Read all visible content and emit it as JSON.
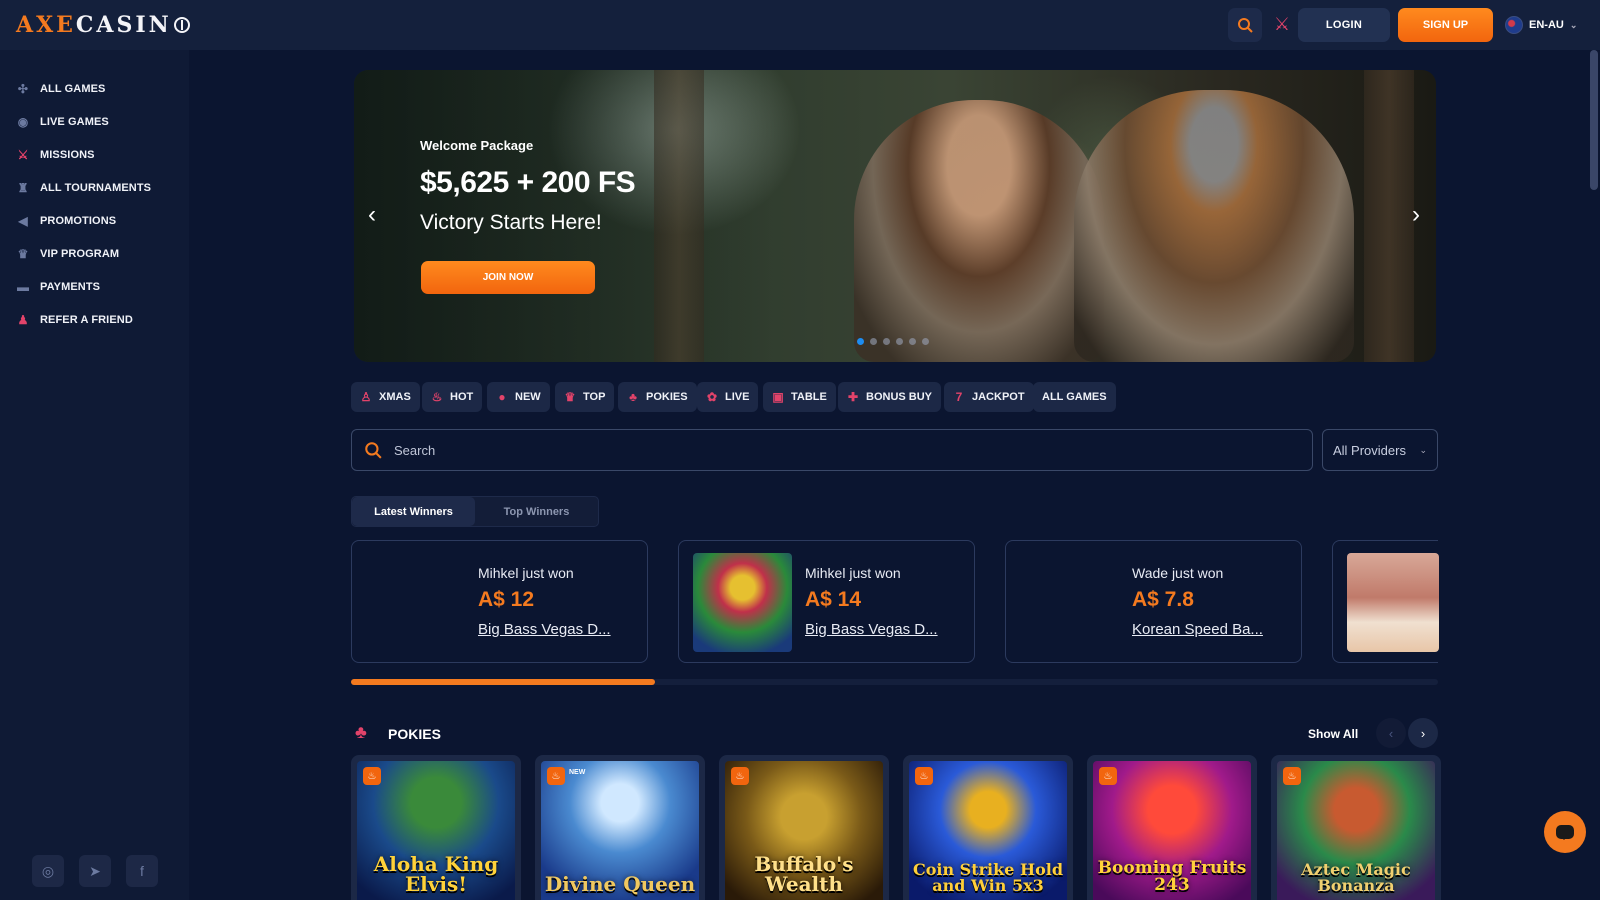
{
  "brand": {
    "logo_text": "AXECASINO",
    "accent": "#f47a1f",
    "pink": "#e2436a"
  },
  "header": {
    "search_icon": "search-icon",
    "missions_icon": "missions-icon",
    "login_label": "LOGIN",
    "signup_label": "SIGN UP",
    "language": "EN-AU"
  },
  "sidebar": {
    "items": [
      {
        "label": "ALL GAMES",
        "icon": "dice-icon"
      },
      {
        "label": "LIVE GAMES",
        "icon": "live-chip-icon"
      },
      {
        "label": "MISSIONS",
        "icon": "missions-icon"
      },
      {
        "label": "ALL TOURNAMENTS",
        "icon": "trophy-icon"
      },
      {
        "label": "PROMOTIONS",
        "icon": "megaphone-icon"
      },
      {
        "label": "VIP PROGRAM",
        "icon": "crown-icon"
      },
      {
        "label": "PAYMENTS",
        "icon": "wallet-icon"
      },
      {
        "label": "REFER A FRIEND",
        "icon": "users-icon"
      }
    ],
    "social": [
      "instagram-icon",
      "telegram-icon",
      "facebook-icon"
    ]
  },
  "banner": {
    "subtitle": "Welcome Package",
    "title": "$5,625 + 200 FS",
    "tagline": "Victory Starts Here!",
    "cta_label": "JOIN NOW",
    "slide_count": 6,
    "active_slide": 1
  },
  "categories": [
    {
      "label": "XMAS",
      "icon": "xmas-icon"
    },
    {
      "label": "HOT",
      "icon": "flame-icon"
    },
    {
      "label": "NEW",
      "icon": "new-icon"
    },
    {
      "label": "TOP",
      "icon": "crown-icon"
    },
    {
      "label": "POKIES",
      "icon": "cherry-icon"
    },
    {
      "label": "LIVE",
      "icon": "live-chip-icon"
    },
    {
      "label": "TABLE",
      "icon": "table-icon"
    },
    {
      "label": "BONUS BUY",
      "icon": "gift-icon"
    },
    {
      "label": "JACKPOT",
      "icon": "seven-icon"
    },
    {
      "label": "ALL GAMES",
      "icon": ""
    }
  ],
  "search": {
    "placeholder": "Search",
    "value": ""
  },
  "providers": {
    "selected": "All Providers"
  },
  "winners": {
    "tabs": [
      {
        "label": "Latest Winners",
        "active": true
      },
      {
        "label": "Top Winners",
        "active": false
      }
    ],
    "cards": [
      {
        "name": "Mihkel just won",
        "amount": "A$ 12",
        "game": "Big Bass Vegas D..."
      },
      {
        "name": "Mihkel just won",
        "amount": "A$ 14",
        "game": "Big Bass Vegas D..."
      },
      {
        "name": "Wade just won",
        "amount": "A$ 7.8",
        "game": "Korean Speed Ba..."
      },
      {
        "name": "",
        "amount": "",
        "game": ""
      }
    ],
    "progress": 0.28
  },
  "pokies": {
    "title": "POKIES",
    "show_all": "Show All",
    "games": [
      {
        "title": "Aloha King Elvis!",
        "hot": true,
        "new": false
      },
      {
        "title": "Divine Queen",
        "hot": true,
        "new": true
      },
      {
        "title": "Buffalo's Wealth",
        "hot": true,
        "new": false
      },
      {
        "title": "Coin Strike Hold and Win 5x3",
        "hot": true,
        "new": false
      },
      {
        "title": "Booming Fruits 243",
        "hot": true,
        "new": false
      },
      {
        "title": "Aztec Magic Bonanza",
        "hot": true,
        "new": false
      }
    ],
    "new_badge": "NEW"
  }
}
